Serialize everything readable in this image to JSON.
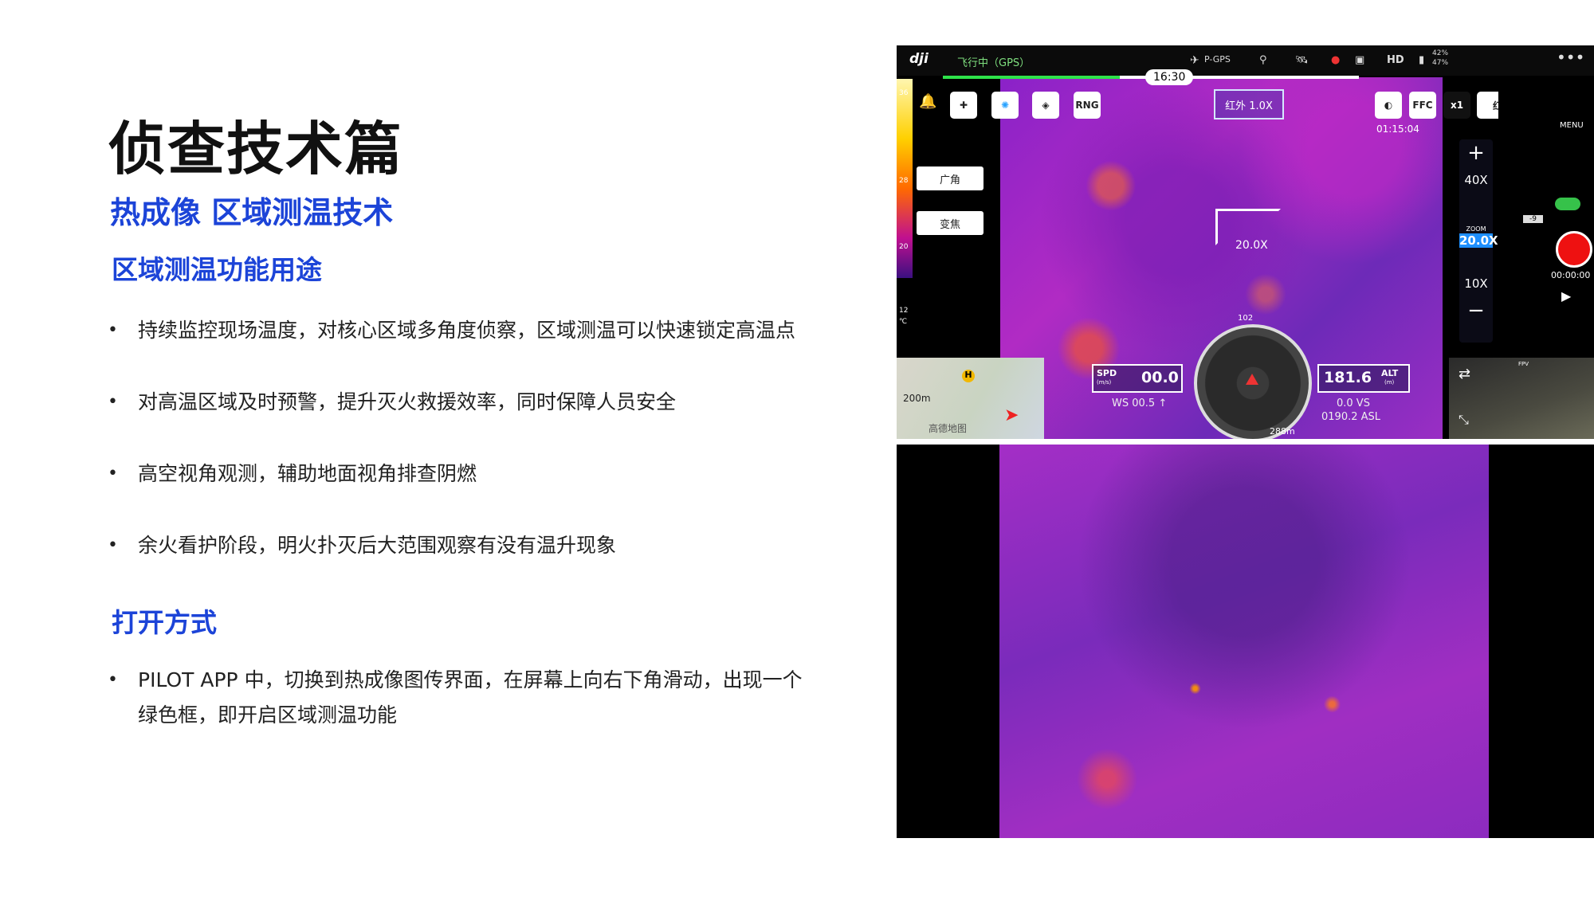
{
  "slide": {
    "title": "侦查技术篇",
    "subtitle": "热成像 区域测温技术",
    "uses_heading": "区域测温功能用途",
    "uses": [
      "持续监控现场温度，对核心区域多角度侦察，区域测温可以快速锁定高温点",
      "对高温区域及时预警，提升灭火救援效率，同时保障人员安全",
      "高空视角观测，辅助地面视角排查阴燃",
      "余火看护阶段，明火扑灭后大范围观察有没有温升现象"
    ],
    "open_heading": "打开方式",
    "open_steps": [
      "PILOT APP 中，切换到热成像图传界面，在屏幕上向右下角滑动，出现一个绿色框，即开启区域测温功能"
    ]
  },
  "app": {
    "logo": "dji",
    "status": "飞行中（GPS）",
    "gps_mode": "P-GPS",
    "hd_label": "HD",
    "battery": [
      "42%",
      "47%"
    ],
    "flight_time": "16:30",
    "mode_buttons": [
      "RNG"
    ],
    "ir_label": "红外 1.0X",
    "ffc_label": "FFC",
    "x1_label": "x1",
    "top_right_mode": "红外",
    "rec_time": "01:15:04",
    "side_buttons": [
      "广角",
      "变焦"
    ],
    "zoom": {
      "plus": "+",
      "max": "40X",
      "current_label": "ZOOM",
      "current": "20.0X",
      "min": "10X",
      "minus": "−"
    },
    "focus_label": "20.0X",
    "menu_label": "MENU",
    "ev_value": "-9",
    "record_timer": "00:00:00",
    "spd": {
      "label": "SPD",
      "unit": "(m/s)",
      "value": "00.0"
    },
    "alt": {
      "label": "ALT",
      "unit": "(m)",
      "value": "181.6"
    },
    "ws": "WS 00.5 ↑",
    "vs": "0.0  VS",
    "asl": "0190.2 ASL",
    "heading": "102",
    "distance": "288m",
    "map_scale": "200m",
    "map_brand": "高德地图",
    "fpv_label": "FPV",
    "temp_scale": [
      "36",
      "28",
      "20",
      "12",
      "℃"
    ]
  }
}
